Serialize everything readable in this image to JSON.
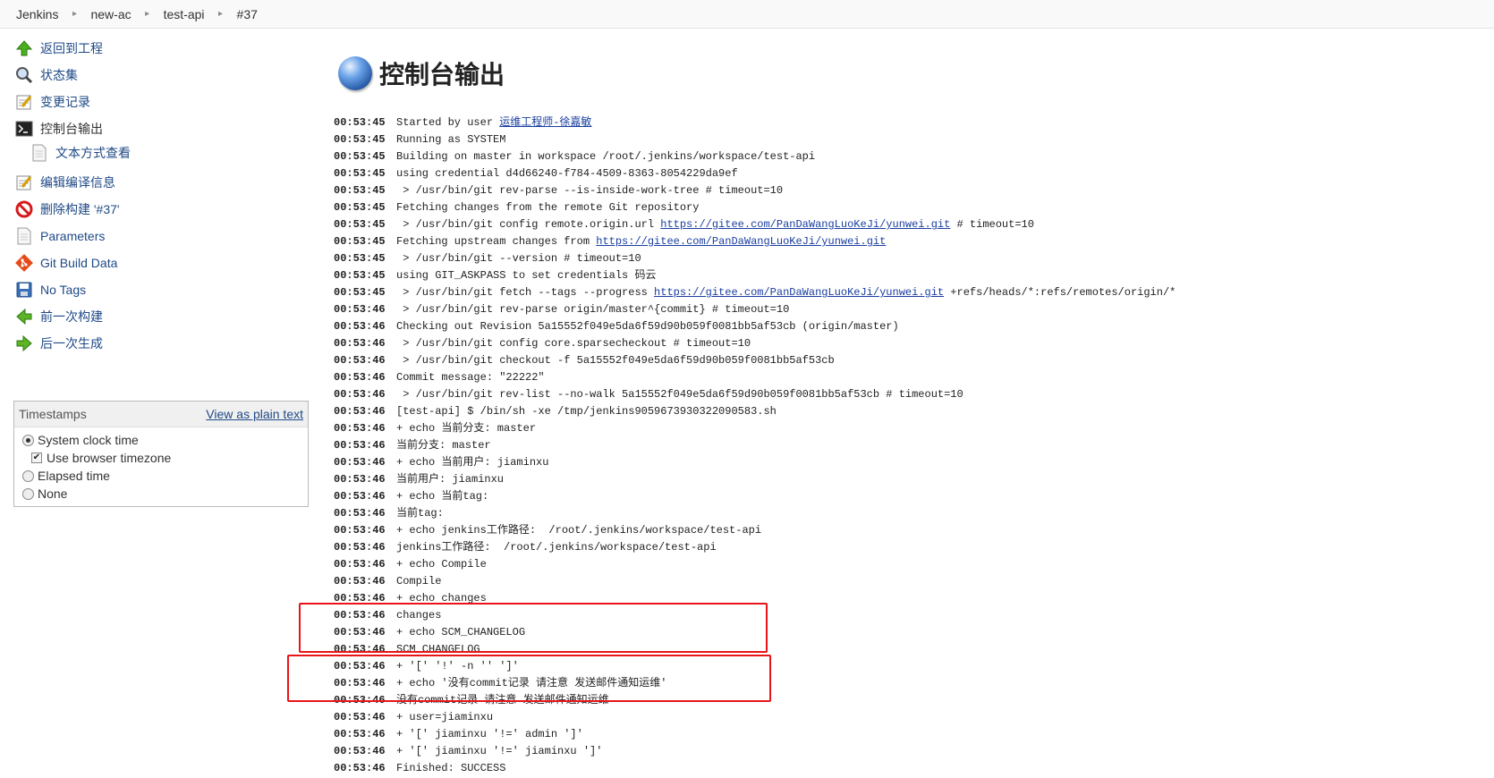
{
  "breadcrumb": [
    "Jenkins",
    "new-ac",
    "test-api",
    "#37"
  ],
  "tasks": [
    {
      "name": "back-to-project",
      "label": "返回到工程",
      "icon": "up-arrow-icon"
    },
    {
      "name": "status",
      "label": "状态集",
      "icon": "magnifier-icon"
    },
    {
      "name": "changes",
      "label": "变更记录",
      "icon": "notepad-icon"
    },
    {
      "name": "console-output",
      "label": "控制台输出",
      "icon": "terminal-icon"
    },
    {
      "name": "plain-text",
      "label": "文本方式查看",
      "icon": "document-icon"
    },
    {
      "name": "edit-build-info",
      "label": "编辑编译信息",
      "icon": "notepad-icon"
    },
    {
      "name": "delete-build",
      "label": "删除构建 '#37'",
      "icon": "no-entry-icon"
    },
    {
      "name": "parameters",
      "label": "Parameters",
      "icon": "document-icon"
    },
    {
      "name": "git-build-data",
      "label": "Git Build Data",
      "icon": "git-icon"
    },
    {
      "name": "no-tags",
      "label": "No Tags",
      "icon": "save-icon"
    },
    {
      "name": "previous-build",
      "label": "前一次构建",
      "icon": "left-arrow-icon"
    },
    {
      "name": "next-build",
      "label": "后一次生成",
      "icon": "right-arrow-icon"
    }
  ],
  "timestamps": {
    "title": "Timestamps",
    "plain_link": "View as plain text",
    "options": [
      "System clock time",
      "Use browser timezone",
      "Elapsed time",
      "None"
    ],
    "selected": "System clock time",
    "browser_tz_checked": true
  },
  "page_title": "控制台输出",
  "console": [
    {
      "t": "00:53:45",
      "parts": [
        {
          "s": "Started by user "
        },
        {
          "s": "运维工程师-徐嘉敏",
          "link": true
        }
      ]
    },
    {
      "t": "00:53:45",
      "parts": [
        {
          "s": "Running as SYSTEM"
        }
      ]
    },
    {
      "t": "00:53:45",
      "parts": [
        {
          "s": "Building on master in workspace /root/.jenkins/workspace/test-api"
        }
      ]
    },
    {
      "t": "00:53:45",
      "parts": [
        {
          "s": "using credential d4d66240-f784-4509-8363-8054229da9ef"
        }
      ]
    },
    {
      "t": "00:53:45",
      "parts": [
        {
          "s": " > /usr/bin/git rev-parse --is-inside-work-tree # timeout=10"
        }
      ]
    },
    {
      "t": "00:53:45",
      "parts": [
        {
          "s": "Fetching changes from the remote Git repository"
        }
      ]
    },
    {
      "t": "00:53:45",
      "parts": [
        {
          "s": " > /usr/bin/git config remote.origin.url "
        },
        {
          "s": "https://gitee.com/PanDaWangLuoKeJi/yunwei.git",
          "link": true
        },
        {
          "s": " # timeout=10"
        }
      ]
    },
    {
      "t": "00:53:45",
      "parts": [
        {
          "s": "Fetching upstream changes from "
        },
        {
          "s": "https://gitee.com/PanDaWangLuoKeJi/yunwei.git",
          "link": true
        }
      ]
    },
    {
      "t": "00:53:45",
      "parts": [
        {
          "s": " > /usr/bin/git --version # timeout=10"
        }
      ]
    },
    {
      "t": "00:53:45",
      "parts": [
        {
          "s": "using GIT_ASKPASS to set credentials 码云"
        }
      ]
    },
    {
      "t": "00:53:45",
      "parts": [
        {
          "s": " > /usr/bin/git fetch --tags --progress "
        },
        {
          "s": "https://gitee.com/PanDaWangLuoKeJi/yunwei.git",
          "link": true
        },
        {
          "s": " +refs/heads/*:refs/remotes/origin/*"
        }
      ]
    },
    {
      "t": "00:53:46",
      "parts": [
        {
          "s": " > /usr/bin/git rev-parse origin/master^{commit} # timeout=10"
        }
      ]
    },
    {
      "t": "00:53:46",
      "parts": [
        {
          "s": "Checking out Revision 5a15552f049e5da6f59d90b059f0081bb5af53cb (origin/master)"
        }
      ]
    },
    {
      "t": "00:53:46",
      "parts": [
        {
          "s": " > /usr/bin/git config core.sparsecheckout # timeout=10"
        }
      ]
    },
    {
      "t": "00:53:46",
      "parts": [
        {
          "s": " > /usr/bin/git checkout -f 5a15552f049e5da6f59d90b059f0081bb5af53cb"
        }
      ]
    },
    {
      "t": "00:53:46",
      "parts": [
        {
          "s": "Commit message: \"22222\""
        }
      ]
    },
    {
      "t": "00:53:46",
      "parts": [
        {
          "s": " > /usr/bin/git rev-list --no-walk 5a15552f049e5da6f59d90b059f0081bb5af53cb # timeout=10"
        }
      ]
    },
    {
      "t": "00:53:46",
      "parts": [
        {
          "s": "[test-api] $ /bin/sh -xe /tmp/jenkins9059673930322090583.sh"
        }
      ]
    },
    {
      "t": "00:53:46",
      "parts": [
        {
          "s": "+ echo 当前分支: master"
        }
      ]
    },
    {
      "t": "00:53:46",
      "parts": [
        {
          "s": "当前分支: master"
        }
      ]
    },
    {
      "t": "00:53:46",
      "parts": [
        {
          "s": "+ echo 当前用户: jiaminxu"
        }
      ]
    },
    {
      "t": "00:53:46",
      "parts": [
        {
          "s": "当前用户: jiaminxu"
        }
      ]
    },
    {
      "t": "00:53:46",
      "parts": [
        {
          "s": "+ echo 当前tag:"
        }
      ]
    },
    {
      "t": "00:53:46",
      "parts": [
        {
          "s": "当前tag:"
        }
      ]
    },
    {
      "t": "00:53:46",
      "parts": [
        {
          "s": "+ echo jenkins工作路径:  /root/.jenkins/workspace/test-api"
        }
      ]
    },
    {
      "t": "00:53:46",
      "parts": [
        {
          "s": "jenkins工作路径:  /root/.jenkins/workspace/test-api"
        }
      ]
    },
    {
      "t": "00:53:46",
      "parts": [
        {
          "s": "+ echo Compile"
        }
      ]
    },
    {
      "t": "00:53:46",
      "parts": [
        {
          "s": "Compile"
        }
      ]
    },
    {
      "t": "00:53:46",
      "parts": [
        {
          "s": "+ echo changes"
        }
      ]
    },
    {
      "t": "00:53:46",
      "parts": [
        {
          "s": "changes"
        }
      ]
    },
    {
      "t": "00:53:46",
      "parts": [
        {
          "s": "+ echo SCM_CHANGELOG"
        }
      ]
    },
    {
      "t": "00:53:46",
      "parts": [
        {
          "s": "SCM_CHANGELOG"
        }
      ]
    },
    {
      "t": "00:53:46",
      "parts": [
        {
          "s": "+ '[' '!' -n '' ']'"
        }
      ]
    },
    {
      "t": "00:53:46",
      "parts": [
        {
          "s": "+ echo '没有commit记录 请注意 发送邮件通知运维'"
        }
      ]
    },
    {
      "t": "00:53:46",
      "parts": [
        {
          "s": "没有commit记录 请注意 发送邮件通知运维"
        }
      ]
    },
    {
      "t": "00:53:46",
      "parts": [
        {
          "s": "+ user=jiaminxu"
        }
      ]
    },
    {
      "t": "00:53:46",
      "parts": [
        {
          "s": "+ '[' jiaminxu '!=' admin ']'"
        }
      ]
    },
    {
      "t": "00:53:46",
      "parts": [
        {
          "s": "+ '[' jiaminxu '!=' jiaminxu ']'"
        }
      ]
    },
    {
      "t": "00:53:46",
      "parts": [
        {
          "s": "Finished: SUCCESS"
        }
      ]
    }
  ],
  "highlight_color": "#e8141a"
}
